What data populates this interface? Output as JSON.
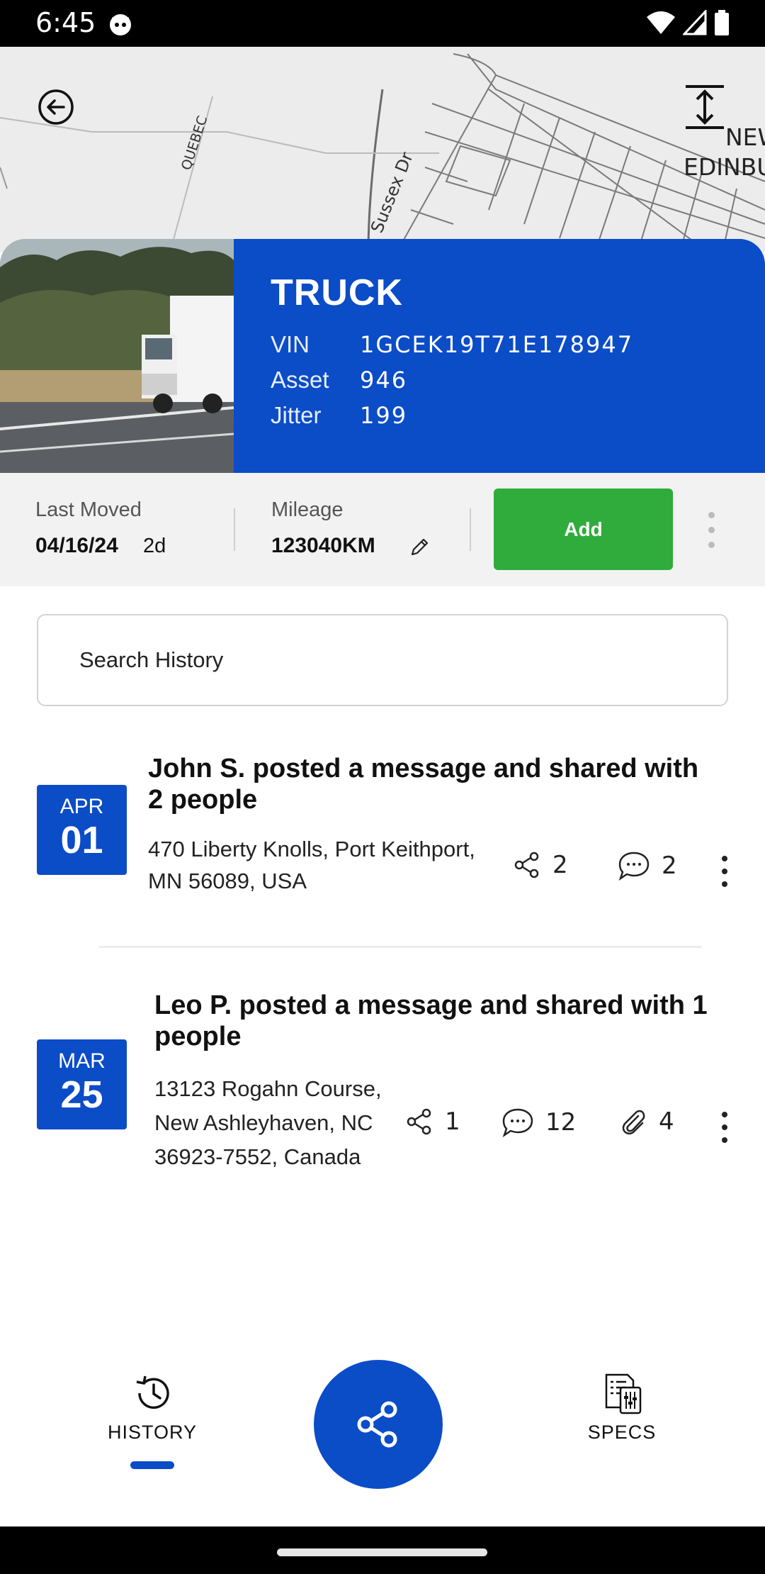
{
  "status_bar": {
    "time": "6:45"
  },
  "map": {
    "labels": [
      "QUEBEC",
      "Sussex Dr",
      "NEW",
      "EDINBU"
    ]
  },
  "asset": {
    "type": "TRUCK",
    "vin_label": "VIN",
    "vin": "1GCEK19T71E178947",
    "asset_label": "Asset",
    "asset_no": "946",
    "jitter_label": "Jitter",
    "jitter": "199"
  },
  "stats": {
    "last_moved_label": "Last Moved",
    "last_moved_date": "04/16/24",
    "last_moved_ago": "2d",
    "mileage_label": "Mileage",
    "mileage_value": "123040KM",
    "add_label": "Add"
  },
  "search": {
    "placeholder": "Search History"
  },
  "history": [
    {
      "month": "APR",
      "day": "01",
      "title": "John S. posted a message and shared with 2 people",
      "address": "470 Liberty Knolls, Port Keithport, MN 56089, USA",
      "shares": "2",
      "comments": "2"
    },
    {
      "month": "MAR",
      "day": "25",
      "title": "Leo P. posted a message and shared with 1 people",
      "address": "13123 Rogahn Course, New Ashleyhaven, NC 36923-7552, Canada",
      "shares": "1",
      "comments": "12",
      "attachments": "4"
    }
  ],
  "bottom_nav": {
    "history_label": "HISTORY",
    "specs_label": "SPECS"
  },
  "colors": {
    "brand_blue": "#0b4cc7",
    "add_green": "#2fac3c"
  }
}
